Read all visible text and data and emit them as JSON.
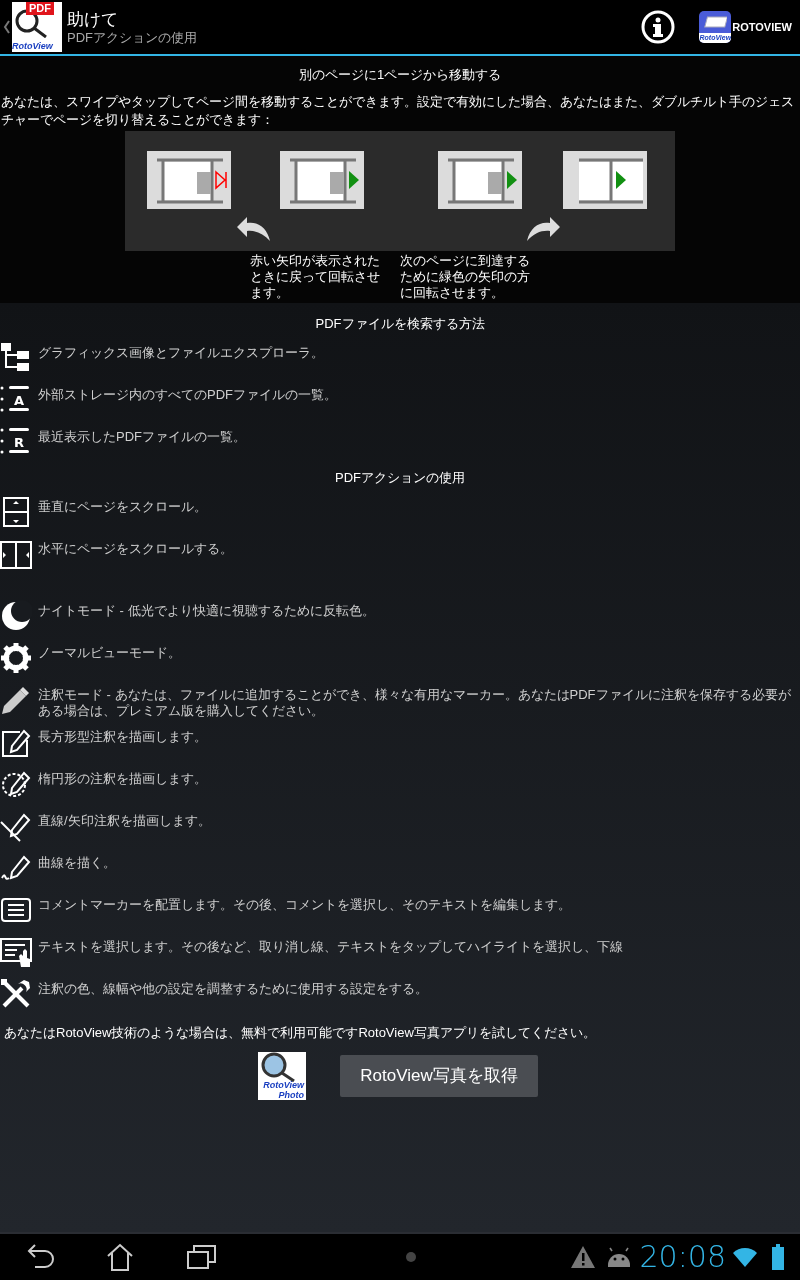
{
  "action_bar": {
    "logo_badge": "PDF",
    "logo_caption": "RotoView",
    "title": "助けて",
    "subtitle": "PDFアクションの使用",
    "brand_icon_caption": "RotoView",
    "brand": "ROTOVIEW"
  },
  "intro": {
    "heading": "別のページに1ページから移動する",
    "body": "あなたは、スワイプやタップしてページ間を移動することができます。設定で有効にした場合、あなたはまた、ダブルチルト手のジェスチャーでページを切り替えることができます：",
    "captions": [
      "赤い矢印が表示されたときに戻って回転させます。",
      "次のページに到達するために緑色の矢印の方に回転させます。"
    ]
  },
  "sections": [
    {
      "heading": "PDFファイルを検索する方法",
      "groups": [
        [
          {
            "kind": "tree",
            "text": "グラフィックス画像とファイルエクスプローラ。"
          },
          {
            "kind": "list",
            "letter": "A",
            "text": "外部ストレージ内のすべてのPDFファイルの一覧。"
          },
          {
            "kind": "list",
            "letter": "R",
            "text": "最近表示したPDFファイルの一覧。"
          }
        ]
      ]
    },
    {
      "heading": "PDFアクションの使用",
      "groups": [
        [
          {
            "kind": "vscroll",
            "text": "垂直にページをスクロール。"
          },
          {
            "kind": "hscroll",
            "text": "水平にページをスクロールする。"
          }
        ],
        [
          {
            "kind": "moon",
            "text": "ナイトモード - 低光でより快適に視聴するために反転色。"
          },
          {
            "kind": "gear",
            "text": "ノーマルビューモード。"
          },
          {
            "kind": "pencil",
            "text": "注釈モード - あなたは、ファイルに追加することができ、様々な有用なマーカー。あなたはPDFファイルに注釈を保存する必要がある場合は、プレミアム版を購入してください。"
          },
          {
            "kind": "rectangle",
            "text": "長方形型注釈を描画します。"
          },
          {
            "kind": "ellipse",
            "text": "楕円形の注釈を描画します。"
          },
          {
            "kind": "line",
            "text": "直線/矢印注釈を描画します。"
          },
          {
            "kind": "curve",
            "text": "曲線を描く。"
          },
          {
            "kind": "comment",
            "text": "コメントマーカーを配置します。その後、コメントを選択し、そのテキストを編集します。"
          },
          {
            "kind": "select",
            "text": "テキストを選択します。その後など、取り消し線、テキストをタップしてハイライトを選択し、下線"
          },
          {
            "kind": "tools",
            "text": "注釈の色、線幅や他の設定を調整するために使用する設定をする。"
          }
        ]
      ]
    }
  ],
  "promo": {
    "text": "あなたはRotoView技術のような場合は、無料で利用可能ですRotoView写真アプリを試してください。",
    "app_icon_caption": [
      "RotoView",
      "Photo"
    ],
    "button": "RotoView写真を取得"
  },
  "status_bar": {
    "time": "20:08"
  }
}
